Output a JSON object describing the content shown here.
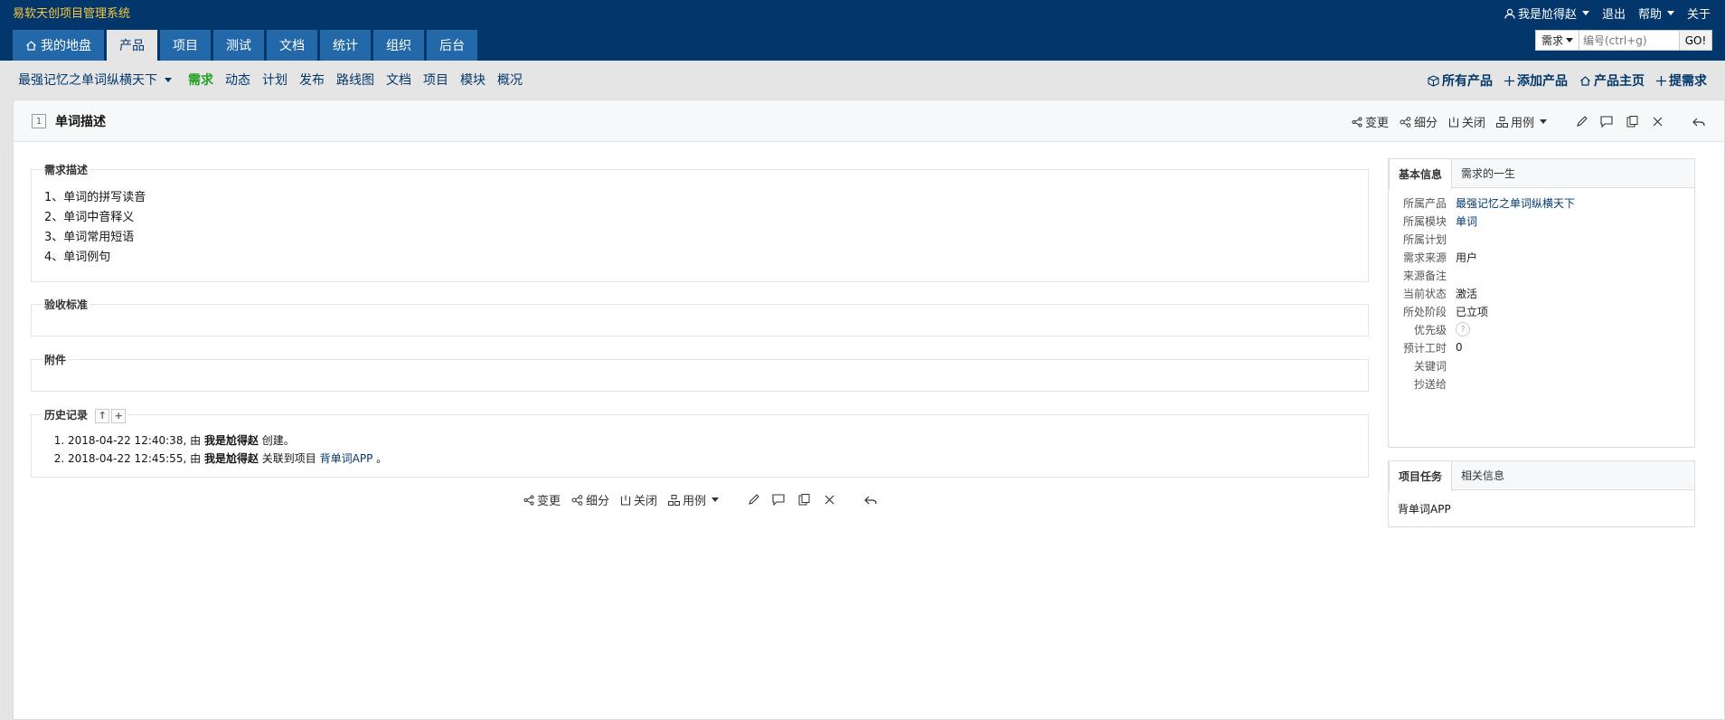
{
  "app_title": "易软天创项目管理系统",
  "user": {
    "name": "我是尬得赵",
    "logout": "退出",
    "help": "帮助",
    "about": "关于"
  },
  "main_tabs": [
    {
      "label": "我的地盘",
      "icon": "home-icon"
    },
    {
      "label": "产品"
    },
    {
      "label": "项目"
    },
    {
      "label": "测试"
    },
    {
      "label": "文档"
    },
    {
      "label": "统计"
    },
    {
      "label": "组织"
    },
    {
      "label": "后台"
    }
  ],
  "search": {
    "type": "需求",
    "placeholder": "编号(ctrl+g)",
    "go": "GO!"
  },
  "subnav": {
    "product": "最强记忆之单词纵横天下",
    "items": [
      "需求",
      "动态",
      "计划",
      "发布",
      "路线图",
      "文档",
      "项目",
      "模块",
      "概况"
    ],
    "right": [
      "所有产品",
      "添加产品",
      "产品主页",
      "提需求"
    ]
  },
  "story": {
    "id": "1",
    "title": "单词描述"
  },
  "actions": {
    "change": "变更",
    "subdivide": "细分",
    "close": "关闭",
    "case": "用例"
  },
  "sections": {
    "description": {
      "title": "需求描述",
      "lines": [
        "1、单词的拼写读音",
        "2、单词中音释义",
        "3、单词常用短语",
        "4、单词例句"
      ]
    },
    "acceptance": {
      "title": "验收标准"
    },
    "files": {
      "title": "附件"
    },
    "history": {
      "title": "历史记录",
      "entries": [
        {
          "time": "2018-04-22 12:40:38,",
          "by": "由",
          "user": "我是尬得赵",
          "action": "创建。",
          "link": ""
        },
        {
          "time": "2018-04-22 12:45:55,",
          "by": "由",
          "user": "我是尬得赵",
          "action": "关联到项目",
          "link": "背单词APP",
          "end": "。"
        }
      ]
    }
  },
  "side": {
    "tabs": [
      "基本信息",
      "需求的一生"
    ],
    "rows": [
      {
        "label": "所属产品",
        "value": "最强记忆之单词纵横天下",
        "link": true
      },
      {
        "label": "所属模块",
        "value": "单词",
        "link": true
      },
      {
        "label": "所属计划",
        "value": ""
      },
      {
        "label": "需求来源",
        "value": "用户"
      },
      {
        "label": "来源备注",
        "value": ""
      },
      {
        "label": "当前状态",
        "value": "激活"
      },
      {
        "label": "所处阶段",
        "value": "已立项"
      },
      {
        "label": "优先级",
        "value": ""
      },
      {
        "label": "预计工时",
        "value": "0"
      },
      {
        "label": "关键词",
        "value": ""
      },
      {
        "label": "抄送给",
        "value": ""
      }
    ],
    "project_tabs": [
      "项目任务",
      "相关信息"
    ],
    "project_task": "背单词APP"
  }
}
